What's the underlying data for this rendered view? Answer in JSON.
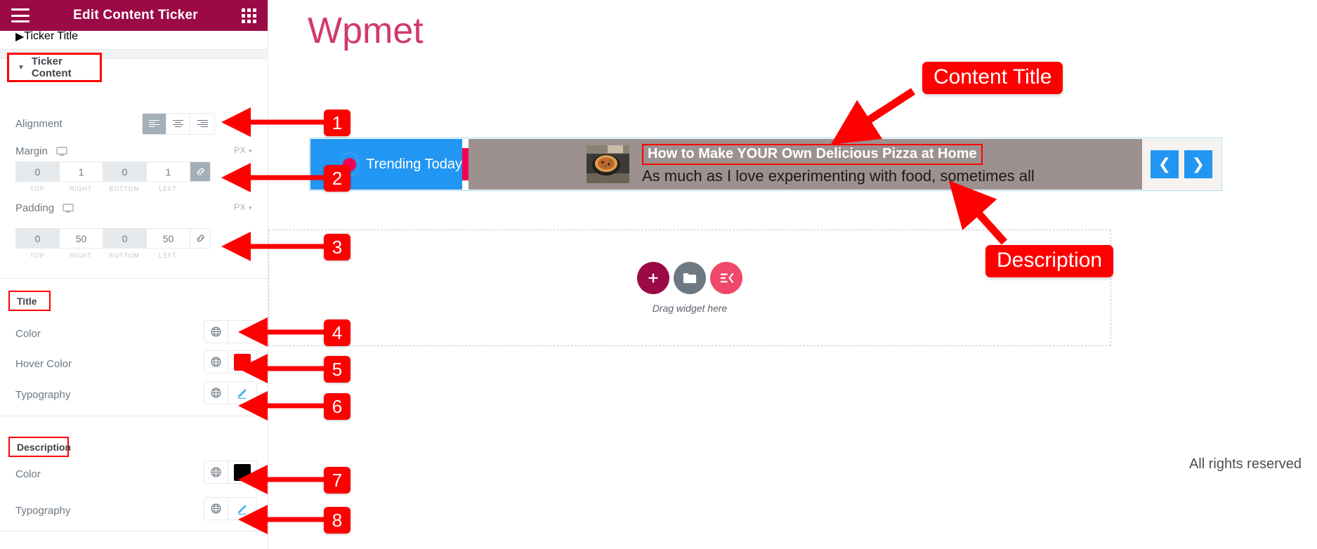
{
  "panel": {
    "header": {
      "title": "Edit Content Ticker",
      "menu_icon": "hamburger-icon",
      "grid_icon": "grid-icon"
    },
    "collapsed_section": {
      "label": "Ticker Title"
    },
    "open_section": {
      "label": "Ticker Content"
    },
    "alignment": {
      "label": "Alignment",
      "options": [
        "left",
        "center",
        "right"
      ],
      "selected": "left"
    },
    "margin": {
      "label": "Margin",
      "unit": "PX",
      "device_icon": "desktop-icon",
      "link_icon": "link-icon",
      "linked": true,
      "values": [
        "0",
        "1",
        "0",
        "1"
      ],
      "captions": [
        "TOP",
        "RIGHT",
        "BOTTOM",
        "LEFT"
      ]
    },
    "padding": {
      "label": "Padding",
      "unit": "PX",
      "device_icon": "desktop-icon",
      "link_icon": "link-icon",
      "linked": false,
      "values": [
        "0",
        "50",
        "0",
        "50"
      ],
      "captions": [
        "TOP",
        "RIGHT",
        "BOTTOM",
        "LEFT"
      ]
    },
    "title_group": {
      "heading": "Title",
      "color": {
        "label": "Color",
        "swatch": "#ffffff",
        "globe_icon": "globe-icon"
      },
      "hover_color": {
        "label": "Hover Color",
        "swatch": "#ff0000",
        "globe_icon": "globe-icon"
      },
      "typography": {
        "label": "Typography",
        "edit_icon": "pencil-icon",
        "globe_icon": "globe-icon"
      }
    },
    "description_group": {
      "heading": "Description",
      "color": {
        "label": "Color",
        "swatch": "#000000",
        "globe_icon": "globe-icon"
      },
      "typography": {
        "label": "Typography",
        "edit_icon": "pencil-icon",
        "globe_icon": "globe-icon"
      }
    },
    "collapse_handle_icon": "chevron-left-icon"
  },
  "canvas": {
    "site_title": "Wpmet",
    "ticker": {
      "label_text": "Trending Today",
      "label_bg": "#2196f3",
      "pulse_dot_color": "#f50057",
      "body_bg": "#9d918f",
      "content_title": "How to Make YOUR Own Delicious Pizza at Home",
      "content_description": "As much as I love experimenting with food, sometimes all",
      "thumbnail_icon": "pizza-thumbnail",
      "prev_icon": "chevron-left-icon",
      "next_icon": "chevron-right-icon",
      "nav_bg": "#2196f3"
    },
    "dropzone": {
      "text": "Drag widget here",
      "buttons": [
        {
          "name": "add-widget",
          "icon": "plus-icon",
          "color": "#9b0a46"
        },
        {
          "name": "add-template",
          "icon": "folder-icon",
          "color": "#6d7882"
        },
        {
          "name": "add-section",
          "icon": "element-kit-icon",
          "color": "#f0486a"
        }
      ]
    },
    "footer_text": "All rights reserved"
  },
  "annotations": {
    "callouts": [
      {
        "id": "content-title",
        "text": "Content Title"
      },
      {
        "id": "description",
        "text": "Description"
      }
    ],
    "badges": [
      "1",
      "2",
      "3",
      "4",
      "5",
      "6",
      "7",
      "8"
    ],
    "accent_color": "#ff0000"
  }
}
